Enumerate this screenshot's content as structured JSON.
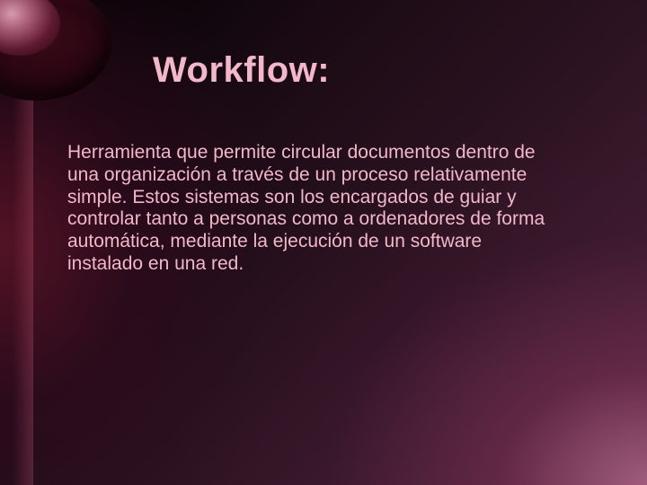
{
  "slide": {
    "title": "Workflow:",
    "body": "Herramienta que permite circular documentos dentro de una organización a través de un proceso relativamente simple. Estos sistemas son los encargados de guiar y controlar tanto a personas como a ordenadores de forma automática, mediante la ejecución de un software instalado en una red."
  }
}
